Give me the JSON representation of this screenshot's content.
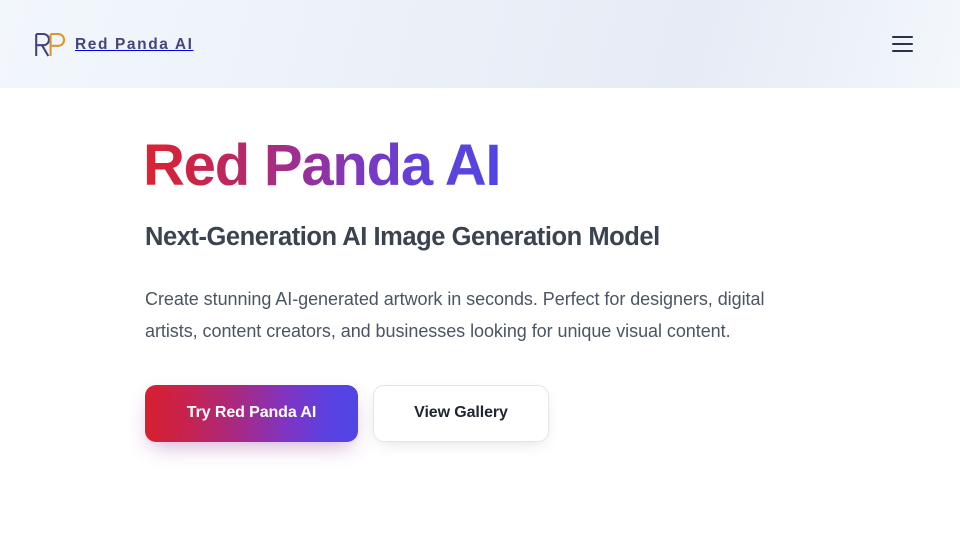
{
  "header": {
    "logo_mark_alt": "RP",
    "logo_letter_primary": "R",
    "logo_letter_secondary": "P",
    "brand_name": "Red Panda AI",
    "menu_icon": "hamburger-menu-icon",
    "colors": {
      "logo_r": "#45457e",
      "logo_p": "#d9982f",
      "brand_text": "#45457e",
      "background_start": "#f2f7fc",
      "background_end": "#e6ebf5"
    }
  },
  "hero": {
    "title": "Red Panda AI",
    "subtitle": "Next-Generation AI Image Generation Model",
    "description": "Create stunning AI-generated artwork in seconds. Perfect for designers, digital artists, content creators, and businesses looking for unique visual content.",
    "title_gradient_from": "#dc2332",
    "title_gradient_mid": "#9b2f94",
    "title_gradient_to": "#5046e5",
    "buttons": {
      "primary_label": "Try Red Panda AI",
      "secondary_label": "View Gallery"
    }
  }
}
